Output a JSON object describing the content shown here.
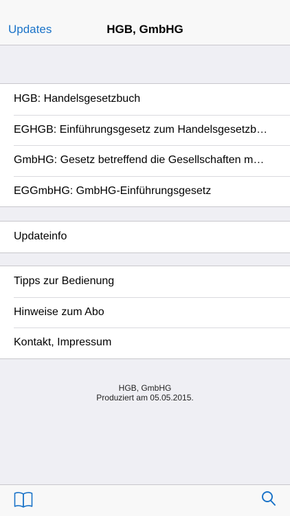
{
  "nav": {
    "back_label": "Updates",
    "title": "HGB, GmbHG"
  },
  "laws": [
    {
      "label": "HGB: Handelsgesetzbuch"
    },
    {
      "label": "EGHGB: Einführungsgesetz zum Handelsgesetzb…"
    },
    {
      "label": "GmbHG: Gesetz betreffend die Gesellschaften m…"
    },
    {
      "label": "EGGmbHG: GmbHG-Einführungsgesetz"
    }
  ],
  "info": [
    {
      "label": "Updateinfo"
    }
  ],
  "help": [
    {
      "label": "Tipps zur Bedienung"
    },
    {
      "label": "Hinweise zum Abo"
    },
    {
      "label": "Kontakt, Impressum"
    }
  ],
  "footer": {
    "line1": "HGB, GmbHG",
    "line2": "Produziert am 05.05.2015."
  },
  "tabbar": {
    "left_icon": "book-icon",
    "right_icon": "search-icon"
  },
  "colors": {
    "accent": "#1a73c8",
    "background": "#efeff4"
  }
}
